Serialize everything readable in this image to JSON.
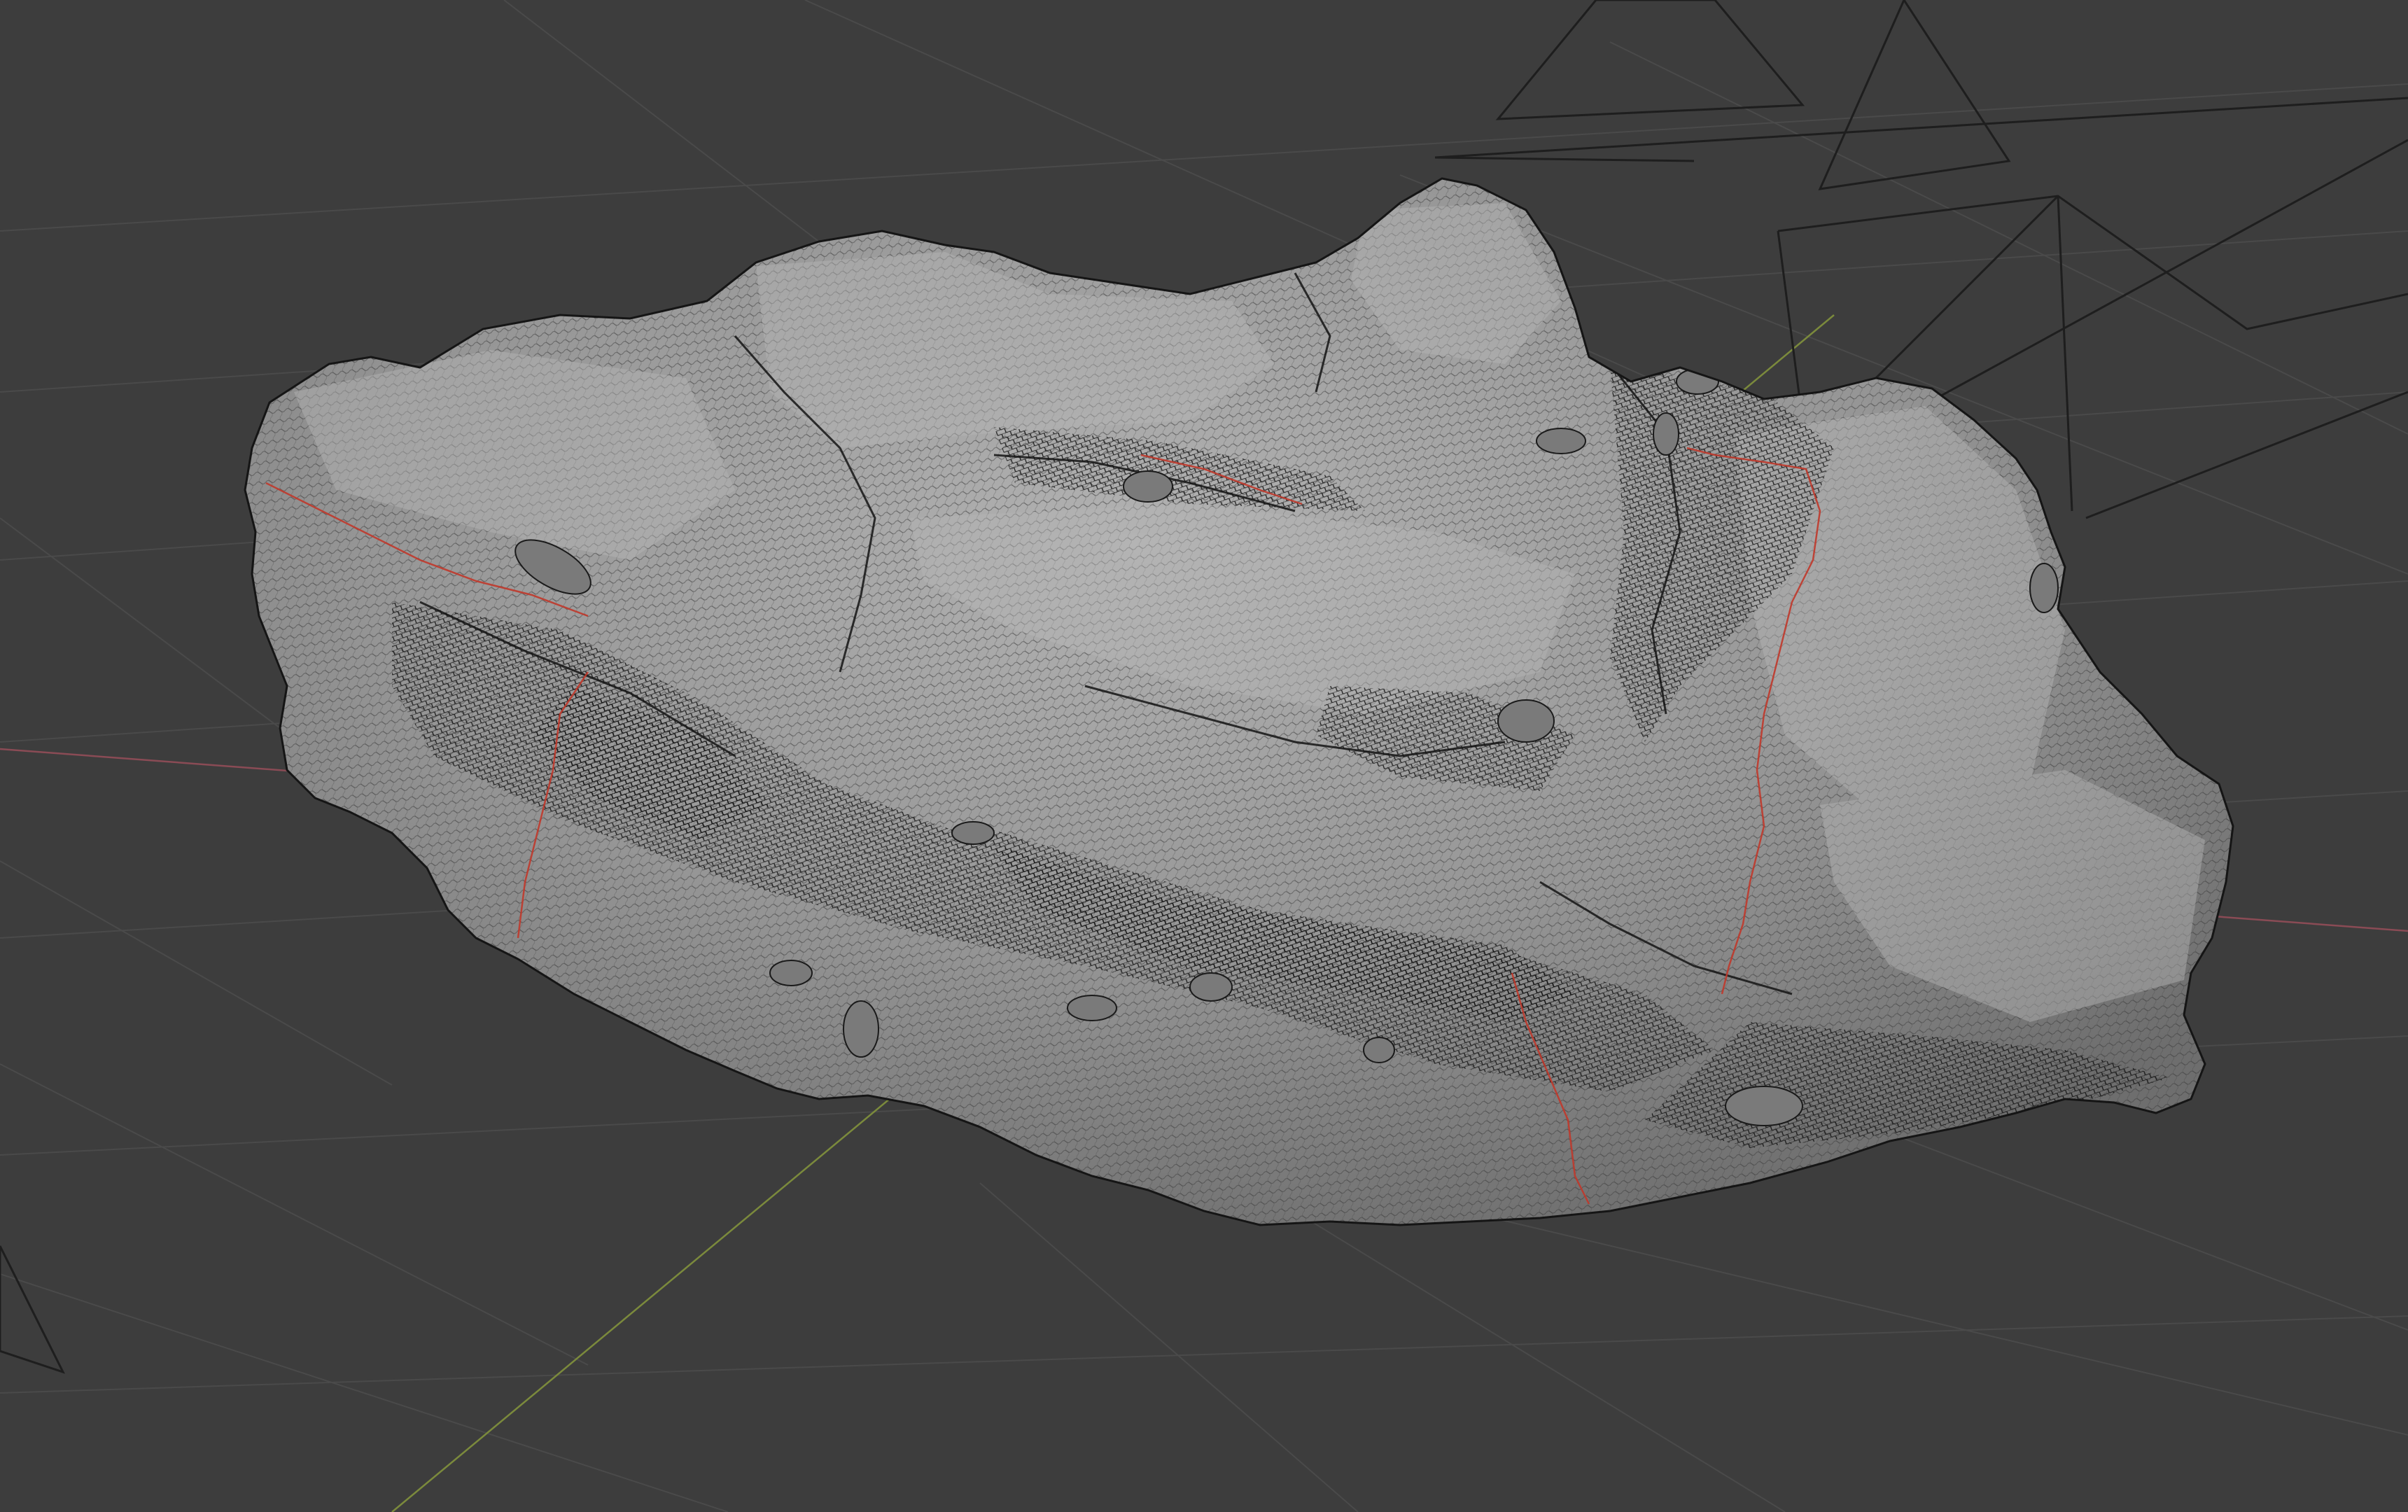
{
  "viewport": {
    "kind": "3d-viewport",
    "shading": "wireframe-overlay",
    "object": "rock-mesh"
  },
  "colors": {
    "background": "#3d3d3d",
    "grid_line": "#4a4a4a",
    "grid_line_dark": "#333333",
    "x_axis": "#8a4b55",
    "y_axis": "#7b8a3c",
    "mesh_base": "#8c8c8c",
    "mesh_light": "#a8a8a8",
    "mesh_dark": "#222222",
    "seam": "#c0392b",
    "camera_frame": "#1e1e1e"
  }
}
